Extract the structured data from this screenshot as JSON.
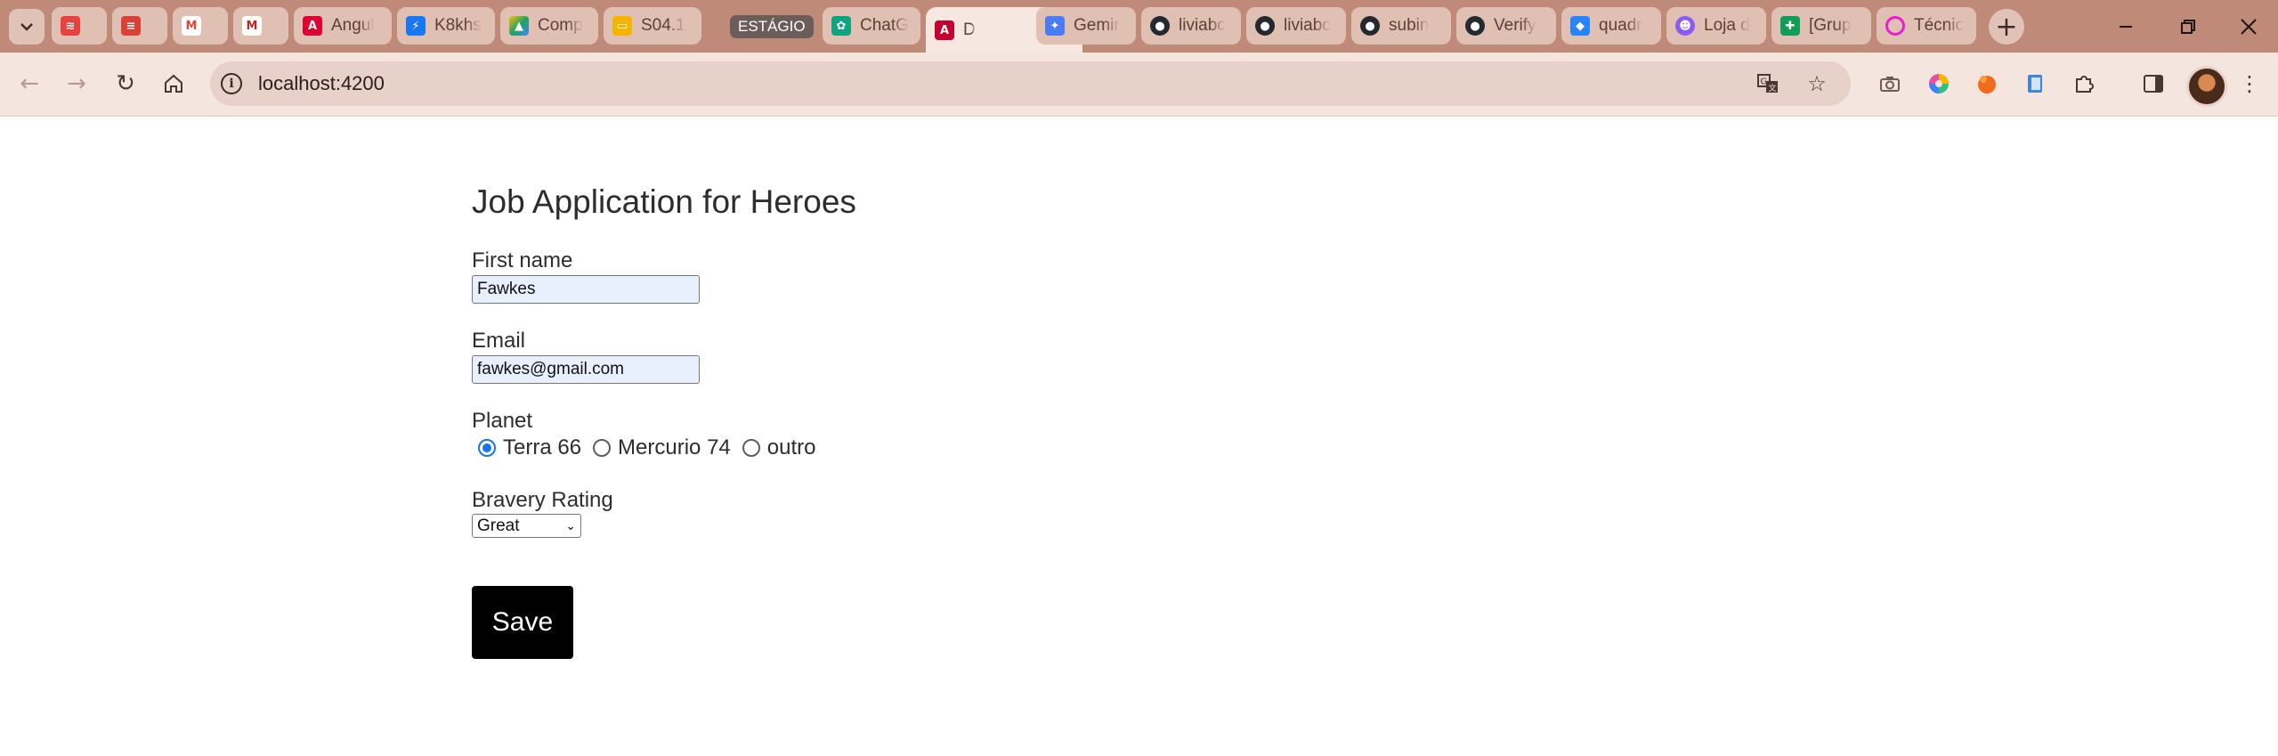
{
  "browser": {
    "tabs": [
      {
        "title": "",
        "icon": "tab-icon-flow",
        "fav_color": "#e8423f"
      },
      {
        "title": "",
        "icon": "tab-icon-todoist",
        "fav_color": "#db4035"
      },
      {
        "title": "",
        "icon": "tab-icon-gmail",
        "fav_color": "#ea4335"
      },
      {
        "title": "",
        "icon": "tab-icon-gmail",
        "fav_color": "#c5221f"
      },
      {
        "title": "Angul",
        "icon": "tab-icon-angular",
        "fav_color": "#dd0031"
      },
      {
        "title": "K8khs",
        "icon": "tab-icon-lightning",
        "fav_color": "#1877f2"
      },
      {
        "title": "Comp",
        "icon": "tab-icon-drive",
        "fav_color": "#1fa463"
      },
      {
        "title": "S04.1",
        "icon": "tab-icon-slides",
        "fav_color": "#f4b400"
      },
      {
        "title": "ChatG",
        "icon": "tab-icon-chatgpt",
        "fav_color": "#10a37f"
      },
      {
        "title": "D",
        "icon": "tab-icon-angular",
        "fav_color": "#c3002f",
        "active": true
      },
      {
        "title": "Gemir",
        "icon": "tab-icon-gemini",
        "fav_color": "#4b7cf3"
      },
      {
        "title": "liviabc",
        "icon": "tab-icon-github",
        "fav_color": "#24292f"
      },
      {
        "title": "liviabc",
        "icon": "tab-icon-github",
        "fav_color": "#24292f"
      },
      {
        "title": "subin",
        "icon": "tab-icon-github",
        "fav_color": "#24292f"
      },
      {
        "title": "Verify",
        "icon": "tab-icon-github",
        "fav_color": "#24292f"
      },
      {
        "title": "quadr",
        "icon": "tab-icon-jira",
        "fav_color": "#2684ff"
      },
      {
        "title": "Loja d",
        "icon": "tab-icon-store",
        "fav_color": "#8a5cf6"
      },
      {
        "title": "[Grup",
        "icon": "tab-icon-sheets",
        "fav_color": "#0f9d58"
      },
      {
        "title": "Técnic",
        "icon": "tab-icon-ring",
        "fav_color": "#e91ecf"
      }
    ],
    "group_label": "ESTÁGIO",
    "url": "localhost:4200"
  },
  "form": {
    "title": "Job Application for Heroes",
    "first_name_label": "First name",
    "first_name_value": "Fawkes",
    "email_label": "Email",
    "email_value": "fawkes@gmail.com",
    "planet_label": "Planet",
    "planet_options": [
      "Terra 66",
      "Mercurio 74",
      "outro"
    ],
    "planet_selected": "Terra 66",
    "bravery_label": "Bravery Rating",
    "bravery_value": "Great",
    "save_label": "Save"
  }
}
